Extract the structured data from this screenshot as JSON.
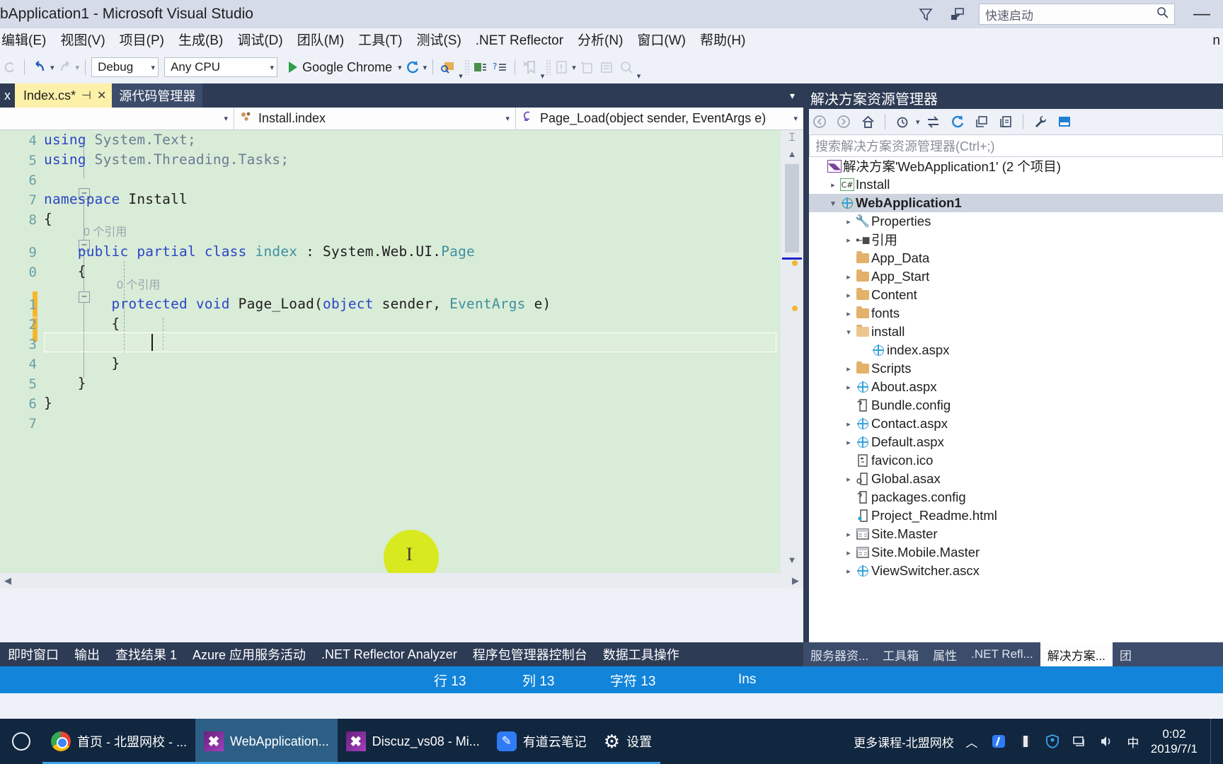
{
  "window": {
    "title": "bApplication1 - Microsoft Visual Studio",
    "minimize_label": "—"
  },
  "quick_launch": {
    "placeholder": "快速启动",
    "search_icon": "search-icon",
    "feedback_icon": "feedback-icon",
    "filter_icon": "filter-icon"
  },
  "menubar": {
    "items": [
      {
        "label": "编辑(E)"
      },
      {
        "label": "视图(V)"
      },
      {
        "label": "项目(P)"
      },
      {
        "label": "生成(B)"
      },
      {
        "label": "调试(D)"
      },
      {
        "label": "团队(M)"
      },
      {
        "label": "工具(T)"
      },
      {
        "label": "测试(S)"
      },
      {
        "label": ".NET Reflector"
      },
      {
        "label": "分析(N)"
      },
      {
        "label": "窗口(W)"
      },
      {
        "label": "帮助(H)"
      }
    ],
    "right_fragment": "n"
  },
  "toolbar": {
    "undo_icon": "undo-icon",
    "redo_icon": "redo-icon",
    "configuration": "Debug",
    "platform": "Any CPU",
    "start_label": "Google Chrome",
    "refresh_icon": "refresh-icon",
    "attach_icon": "attach-to-process-icon",
    "comment_icon": "comment-selection-icon",
    "uncomment_icon": "uncomment-selection-icon",
    "bookmark_icon": "bookmark-icon",
    "error_icon": "error-list-icon",
    "newitem_icon": "new-item-icon",
    "prop_icon": "properties-icon",
    "find_icon": "find-icon"
  },
  "editor": {
    "ghost_tab": "x",
    "tabs": [
      {
        "label": "Index.cs*",
        "dirty": true,
        "pin_icon": "pin-icon",
        "close_icon": "close-icon"
      },
      {
        "label": "源代码管理器"
      }
    ],
    "tabrow_caret": "chevron-down-icon",
    "navbar": {
      "project": "",
      "type_icon": "class-icon",
      "type": "Install.index",
      "member_icon": "method-icon",
      "member": "Page_Load(object sender, EventArgs e)"
    },
    "lines": [
      {
        "num": "4",
        "tokens": [
          [
            "kw",
            "using "
          ],
          [
            "ns-gray",
            "System.Text;"
          ]
        ]
      },
      {
        "num": "5",
        "tokens": [
          [
            "kw",
            "using "
          ],
          [
            "ns-gray",
            "System.Threading.Tasks;"
          ]
        ]
      },
      {
        "num": "6",
        "tokens": [
          [
            "plain",
            ""
          ]
        ]
      },
      {
        "num": "7",
        "tokens": [
          [
            "kw",
            "namespace "
          ],
          [
            "plain",
            "Install"
          ]
        ]
      },
      {
        "num": "8",
        "tokens": [
          [
            "plain",
            "{"
          ]
        ]
      },
      {
        "num": "9",
        "tokens": [
          [
            "kw",
            "    public partial class "
          ],
          [
            "type",
            "index"
          ],
          [
            "plain",
            " : "
          ],
          [
            "plain",
            "System.Web.UI."
          ],
          [
            "type",
            "Page"
          ]
        ]
      },
      {
        "num": "0",
        "tokens": [
          [
            "plain",
            "    {"
          ]
        ]
      },
      {
        "num": "1",
        "tokens": [
          [
            "kw",
            "        protected void "
          ],
          [
            "plain",
            "Page_Load("
          ],
          [
            "kw",
            "object"
          ],
          [
            "plain",
            " sender, "
          ],
          [
            "type",
            "EventArgs"
          ],
          [
            "plain",
            " e)"
          ]
        ]
      },
      {
        "num": "2",
        "tokens": [
          [
            "plain",
            "        {"
          ]
        ]
      },
      {
        "num": "3",
        "tokens": [
          [
            "plain",
            ""
          ]
        ]
      },
      {
        "num": "4",
        "tokens": [
          [
            "plain",
            "        }"
          ]
        ]
      },
      {
        "num": "5",
        "tokens": [
          [
            "plain",
            "    }"
          ]
        ]
      },
      {
        "num": "6",
        "tokens": [
          [
            "plain",
            "}"
          ]
        ]
      },
      {
        "num": "7",
        "tokens": [
          [
            "plain",
            ""
          ]
        ]
      }
    ],
    "reference_hints": [
      {
        "text": "0 个引用",
        "line": 9
      },
      {
        "text": "0 个引用",
        "line": 11
      }
    ]
  },
  "solution_explorer": {
    "title": "解决方案资源管理器",
    "search_placeholder": "搜索解决方案资源管理器(Ctrl+;)",
    "toolbar_icons": [
      "back-icon",
      "forward-icon",
      "home-icon",
      "pending-changes-icon",
      "sync-with-active-document-icon",
      "refresh-icon",
      "collapse-all-icon",
      "show-all-files-icon",
      "properties-icon",
      "preview-selected-items-icon"
    ],
    "tree": [
      {
        "indent": 0,
        "twisty": "",
        "icon": "solution-icon",
        "label": "解决方案'WebApplication1' (2 个项目)"
      },
      {
        "indent": 1,
        "twisty": "▸",
        "icon": "csharp-project-icon",
        "label": "Install"
      },
      {
        "indent": 1,
        "twisty": "▾",
        "icon": "web-project-icon",
        "label": "WebApplication1",
        "selected": true
      },
      {
        "indent": 2,
        "twisty": "▸",
        "icon": "wrench-icon",
        "label": "Properties"
      },
      {
        "indent": 2,
        "twisty": "▸",
        "icon": "references-icon",
        "label": "引用"
      },
      {
        "indent": 2,
        "twisty": "",
        "icon": "folder-icon",
        "label": "App_Data"
      },
      {
        "indent": 2,
        "twisty": "▸",
        "icon": "folder-icon",
        "label": "App_Start"
      },
      {
        "indent": 2,
        "twisty": "▸",
        "icon": "folder-icon",
        "label": "Content"
      },
      {
        "indent": 2,
        "twisty": "▸",
        "icon": "folder-icon",
        "label": "fonts"
      },
      {
        "indent": 2,
        "twisty": "▾",
        "icon": "folder-open-icon",
        "label": "install"
      },
      {
        "indent": 3,
        "twisty": "",
        "icon": "aspx-icon",
        "label": "index.aspx"
      },
      {
        "indent": 2,
        "twisty": "▸",
        "icon": "folder-icon",
        "label": "Scripts"
      },
      {
        "indent": 2,
        "twisty": "▸",
        "icon": "aspx-icon",
        "label": "About.aspx"
      },
      {
        "indent": 2,
        "twisty": "",
        "icon": "config-icon",
        "label": "Bundle.config"
      },
      {
        "indent": 2,
        "twisty": "▸",
        "icon": "aspx-icon",
        "label": "Contact.aspx"
      },
      {
        "indent": 2,
        "twisty": "▸",
        "icon": "aspx-icon",
        "label": "Default.aspx"
      },
      {
        "indent": 2,
        "twisty": "",
        "icon": "ico-icon",
        "label": "favicon.ico"
      },
      {
        "indent": 2,
        "twisty": "▸",
        "icon": "asax-icon",
        "label": "Global.asax"
      },
      {
        "indent": 2,
        "twisty": "",
        "icon": "config-icon",
        "label": "packages.config"
      },
      {
        "indent": 2,
        "twisty": "",
        "icon": "html-icon",
        "label": "Project_Readme.html"
      },
      {
        "indent": 2,
        "twisty": "▸",
        "icon": "master-page-icon",
        "label": "Site.Master"
      },
      {
        "indent": 2,
        "twisty": "▸",
        "icon": "master-page-icon",
        "label": "Site.Mobile.Master"
      },
      {
        "indent": 2,
        "twisty": "▸",
        "icon": "ascx-icon",
        "label": "ViewSwitcher.ascx"
      }
    ],
    "tabs": [
      {
        "label": "服务器资..."
      },
      {
        "label": "工具箱"
      },
      {
        "label": "属性"
      },
      {
        "label": ".NET Refl..."
      },
      {
        "label": "解决方案...",
        "active": true
      },
      {
        "label": "团"
      }
    ]
  },
  "bottom_tabs": [
    {
      "label": "即时窗口"
    },
    {
      "label": "输出"
    },
    {
      "label": "查找结果 1"
    },
    {
      "label": "Azure 应用服务活动"
    },
    {
      "label": ".NET Reflector Analyzer"
    },
    {
      "label": "程序包管理器控制台"
    },
    {
      "label": "数据工具操作"
    }
  ],
  "statusbar": {
    "line": "行 13",
    "column": "列 13",
    "character": "字符 13",
    "insert_mode": "Ins",
    "background": "#1284da"
  },
  "taskbar": {
    "start_icon": "start-icon",
    "buttons": [
      {
        "label": "首页 - 北盟网校 - ...",
        "icon": "chrome-icon"
      },
      {
        "label": "WebApplication...",
        "icon": "visual-studio-icon",
        "active": true
      },
      {
        "label": "Discuz_vs08 - Mi...",
        "icon": "visual-studio-icon"
      },
      {
        "label": "有道云笔记",
        "icon": "youdao-note-icon"
      },
      {
        "label": "设置",
        "icon": "settings-gear-icon"
      }
    ],
    "tray_text": "更多课程-北盟网校",
    "tray_icons": [
      "chevron-up-icon",
      "youdao-tray-icon",
      "recorder-tray-icon",
      "security-shield-icon",
      "network-icon",
      "volume-icon",
      "ime-icon"
    ],
    "clock_time": "0:02",
    "clock_date": "2019/7/1"
  }
}
